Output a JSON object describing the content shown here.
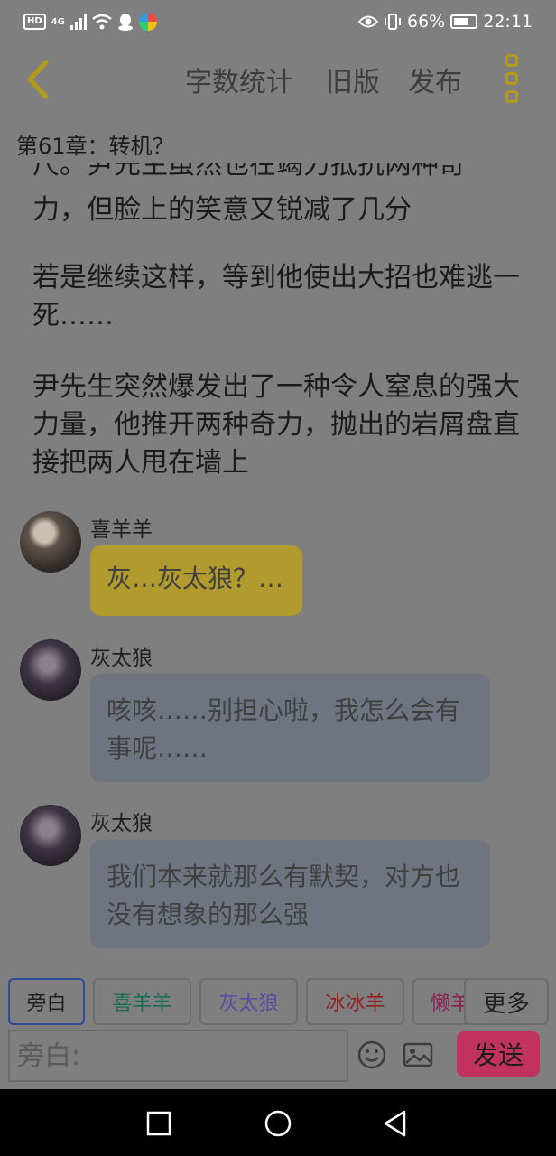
{
  "status_bar": {
    "hd": "HD",
    "network": "4G",
    "battery_percent": "66%",
    "time": "22:11",
    "icons": [
      "wifi-icon",
      "qq-icon",
      "color-app-icon",
      "eye-icon",
      "vibrate-icon",
      "battery-icon"
    ]
  },
  "top_bar": {
    "back_icon": "chevron-left-icon",
    "word_count": "字数统计",
    "old_version": "旧版",
    "publish": "发布",
    "more_icon": "more-vertical-icon",
    "accent_color": "#b39a1c"
  },
  "chapter_title": "第61章：转机？",
  "content": {
    "partial_top_line": "尺。尹先生虽然也在竭力抵抗两种奇",
    "paragraphs": [
      "力，但脸上的笑意又锐减了几分",
      "若是继续这样，等到他使出大招也难逃一死……",
      "尹先生突然爆发出了一种令人窒息的强大力量，他推开两种奇力，抛出的岩屑盘直接把两人甩在墙上"
    ],
    "messages": [
      {
        "name": "喜羊羊",
        "text": "灰…灰太狼？…",
        "bubble_color": "#b19b2e"
      },
      {
        "name": "灰太狼",
        "text": "咳咳……别担心啦，我怎么会有事呢……",
        "bubble_color": "#6e7580"
      },
      {
        "name": "灰太狼",
        "text": "我们本来就那么有默契，对方也没有想象的那么强",
        "bubble_color": "#6e7580"
      }
    ]
  },
  "roles": {
    "narration": "旁白",
    "xiyangyang": "喜羊羊",
    "huitailang": "灰太狼",
    "bingbingyang": "冰冰羊",
    "lanyangyang": "懒羊",
    "more": "更多"
  },
  "input": {
    "placeholder": "旁白:",
    "emoji_icon": "emoji-icon",
    "image_icon": "image-icon",
    "send": "发送",
    "send_color": "#c2325f"
  },
  "nav_bar": {
    "icons": [
      "recent-apps-icon",
      "home-icon",
      "back-icon"
    ]
  }
}
